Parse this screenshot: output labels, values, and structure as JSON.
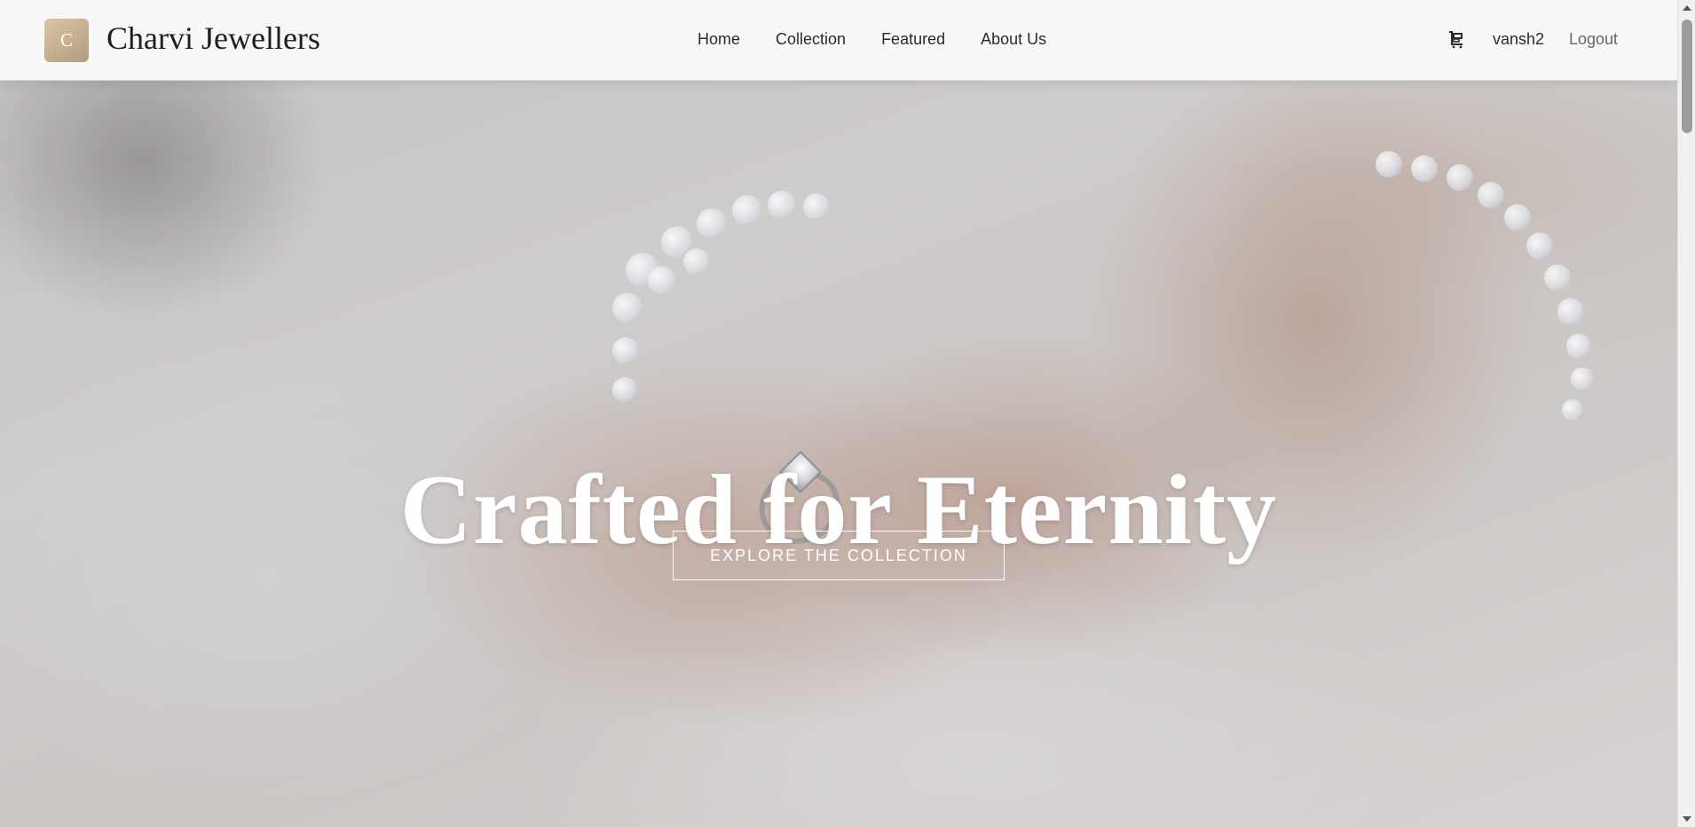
{
  "brand": {
    "logo_letter": "C",
    "name": "Charvi Jewellers"
  },
  "nav": {
    "links": [
      "Home",
      "Collection",
      "Featured",
      "About Us"
    ]
  },
  "user": {
    "cart_icon": "shopping-cart-icon",
    "username": "vansh2",
    "logout_label": "Logout"
  },
  "hero": {
    "title": "Crafted for Eternity",
    "cta_label": "EXPLORE THE COLLECTION"
  },
  "colors": {
    "navbar_bg": "#f8f8f8",
    "logo_gradient_start": "#d8c6a7",
    "logo_gradient_end": "#b39b7d",
    "hero_text": "#ffffff"
  }
}
